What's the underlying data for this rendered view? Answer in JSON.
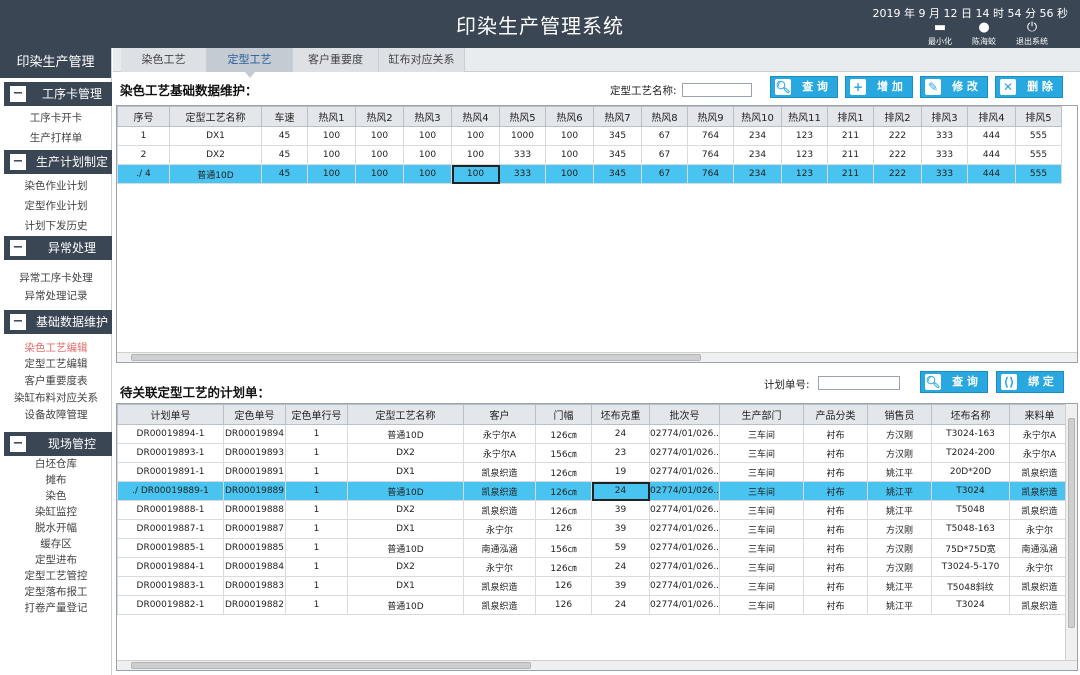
{
  "header": {
    "title": "印染生产管理系统",
    "datetime": "2019 年 9 月 12 日  14 时 54 分 56 秒",
    "minimize_label": "最小化",
    "user_label": "陈海蛟",
    "exit_label": "退出系统"
  },
  "sidebar": {
    "title": "印染生产管理",
    "groups": [
      {
        "label": "工序卡管理",
        "items": [
          "工序卡开卡",
          "生产打样单"
        ]
      },
      {
        "label": "生产计划制定",
        "items": [
          "染色作业计划",
          "定型作业计划",
          "计划下发历史"
        ]
      },
      {
        "label": "异常处理",
        "items": [
          "异常工序卡处理",
          "异常处理记录"
        ]
      },
      {
        "label": "基础数据维护",
        "items": [
          "染色工艺编辑",
          "定型工艺编辑",
          "客户重要度表",
          "染缸布料对应关系",
          "设备故障管理"
        ]
      },
      {
        "label": "现场管控",
        "items": [
          "白坯仓库",
          "摊布",
          "染色",
          "染缸监控",
          "脱水开幅",
          "缓存区",
          "定型进布",
          "定型工艺管控",
          "定型落布报工",
          "打卷产量登记"
        ]
      }
    ],
    "active_item": "染色工艺编辑"
  },
  "tabs": [
    "染色工艺",
    "定型工艺",
    "客户重要度",
    "缸布对应关系"
  ],
  "active_tab": "定型工艺",
  "section1": {
    "title": "染色工艺基础数据维护：",
    "search_label": "定型工艺名称:",
    "search_value": "",
    "buttons": {
      "query": "查 询",
      "add": "增 加",
      "edit": "修 改",
      "delete": "删 除"
    },
    "columns": [
      "序号",
      "定型工艺名称",
      "车速",
      "热风1",
      "热风2",
      "热风3",
      "热风4",
      "热风5",
      "热风6",
      "热风7",
      "热风8",
      "热风9",
      "热风10",
      "热风11",
      "排风1",
      "排风2",
      "排风3",
      "排风4",
      "排风5"
    ],
    "rows": [
      [
        "1",
        "DX1",
        "45",
        "100",
        "100",
        "100",
        "100",
        "1000",
        "100",
        "345",
        "67",
        "764",
        "234",
        "123",
        "211",
        "222",
        "333",
        "444",
        "555"
      ],
      [
        "2",
        "DX2",
        "45",
        "100",
        "100",
        "100",
        "100",
        "333",
        "100",
        "345",
        "67",
        "764",
        "234",
        "123",
        "211",
        "222",
        "333",
        "444",
        "555"
      ],
      [
        "./ 4",
        "普通10D",
        "45",
        "100",
        "100",
        "100",
        "100",
        "333",
        "100",
        "345",
        "67",
        "764",
        "234",
        "123",
        "211",
        "222",
        "333",
        "444",
        "555"
      ]
    ]
  },
  "section2": {
    "title": "待关联定型工艺的计划单：",
    "search_label": "计划单号:",
    "search_value": "",
    "buttons": {
      "query": "查 询",
      "bind": "绑 定"
    },
    "columns": [
      "计划单号",
      "定色单号",
      "定色单行号",
      "定型工艺名称",
      "客户",
      "门幅",
      "坯布克重",
      "批次号",
      "生产部门",
      "产品分类",
      "销售员",
      "坯布名称",
      "来料单"
    ],
    "rows": [
      [
        "DR00019894-1",
        "DR00019894",
        "1",
        "普通10D",
        "永宁尔A",
        "126㎝",
        "24",
        "02774/01/026...",
        "三车间",
        "衬布",
        "方汉刚",
        "T3024-163",
        "永宁尔A"
      ],
      [
        "DR00019893-1",
        "DR00019893",
        "1",
        "DX2",
        "永宁尔A",
        "156㎝",
        "23",
        "02774/01/026...",
        "三车间",
        "衬布",
        "方汉刚",
        "T2024-200",
        "永宁尔A"
      ],
      [
        "DR00019891-1",
        "DR00019891",
        "1",
        "DX1",
        "凯泉织造",
        "126㎝",
        "19",
        "02774/01/026...",
        "三车间",
        "衬布",
        "姚江平",
        "20D*20D",
        "凯泉织造"
      ],
      [
        "./ DR00019889-1",
        "DR00019889",
        "1",
        "普通10D",
        "凯泉织造",
        "126㎝",
        "24",
        "02774/01/026...",
        "三车间",
        "衬布",
        "姚江平",
        "T3024",
        "凯泉织造"
      ],
      [
        "DR00019888-1",
        "DR00019888",
        "1",
        "DX2",
        "凯泉织造",
        "126㎝",
        "39",
        "02774/01/026...",
        "三车间",
        "衬布",
        "姚江平",
        "T5048",
        "凯泉织造"
      ],
      [
        "DR00019887-1",
        "DR00019887",
        "1",
        "DX1",
        "永宁尔",
        "126",
        "39",
        "02774/01/026...",
        "三车间",
        "衬布",
        "方汉刚",
        "T5048-163",
        "永宁尔"
      ],
      [
        "DR00019885-1",
        "DR00019885",
        "1",
        "普通10D",
        "南通泓涵",
        "156㎝",
        "59",
        "02774/01/026...",
        "三车间",
        "衬布",
        "方汉刚",
        "75D*75D宽",
        "南通泓涵"
      ],
      [
        "DR00019884-1",
        "DR00019884",
        "1",
        "DX2",
        "永宁尔",
        "126㎝",
        "24",
        "02774/01/026...",
        "三车间",
        "衬布",
        "方汉刚",
        "T3024-5-170",
        "永宁尔"
      ],
      [
        "DR00019883-1",
        "DR00019883",
        "1",
        "DX1",
        "凯泉织造",
        "126",
        "39",
        "02774/01/026...",
        "三车间",
        "衬布",
        "姚江平",
        "T5048斜纹",
        "凯泉织造"
      ],
      [
        "DR00019882-1",
        "DR00019882",
        "1",
        "普通10D",
        "凯泉织造",
        "126",
        "24",
        "02774/01/026...",
        "三车间",
        "衬布",
        "姚江平",
        "T3024",
        "凯泉织造"
      ]
    ]
  }
}
